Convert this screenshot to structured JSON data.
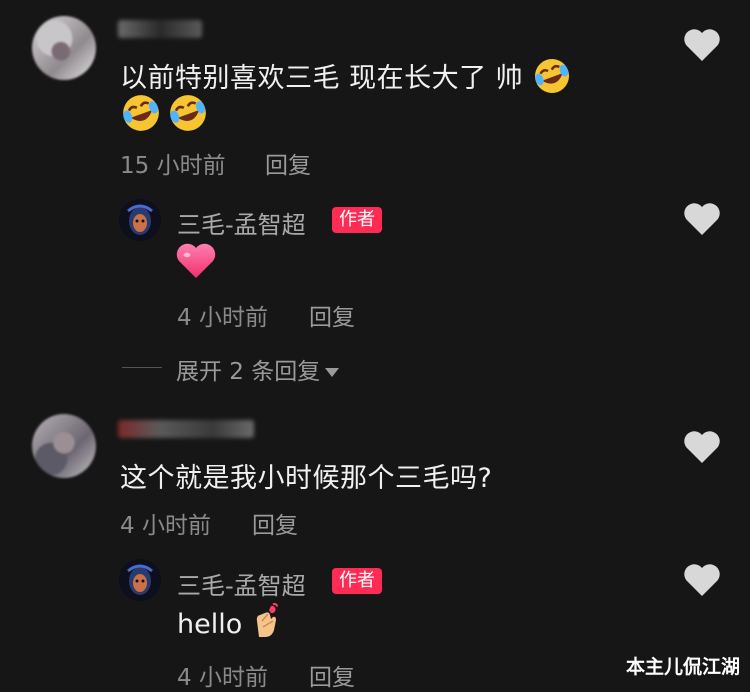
{
  "comments": [
    {
      "text": "以前特别喜欢三毛 现在长大了 帅",
      "time": "15 小时前",
      "reply_label": "回复",
      "emoji": "rofl-emoji",
      "reply": {
        "author": "三毛-孟智超",
        "badge": "作者",
        "text": "",
        "emoji": "pink-heart-emoji",
        "time": "4 小时前",
        "reply_label": "回复"
      },
      "expand_label": "展开 2 条回复"
    },
    {
      "text": "这个就是我小时候那个三毛吗?",
      "time": "4 小时前",
      "reply_label": "回复",
      "reply": {
        "author": "三毛-孟智超",
        "badge": "作者",
        "text": "hello",
        "emoji": "finger-heart-emoji",
        "time": "4 小时前",
        "reply_label": "回复"
      }
    }
  ],
  "watermark": "本主儿侃江湖",
  "colors": {
    "background": "#161616",
    "badge": "#fe2c55",
    "muted_text": "#8a8a8a",
    "heart_icon": "#d8d8d8"
  }
}
